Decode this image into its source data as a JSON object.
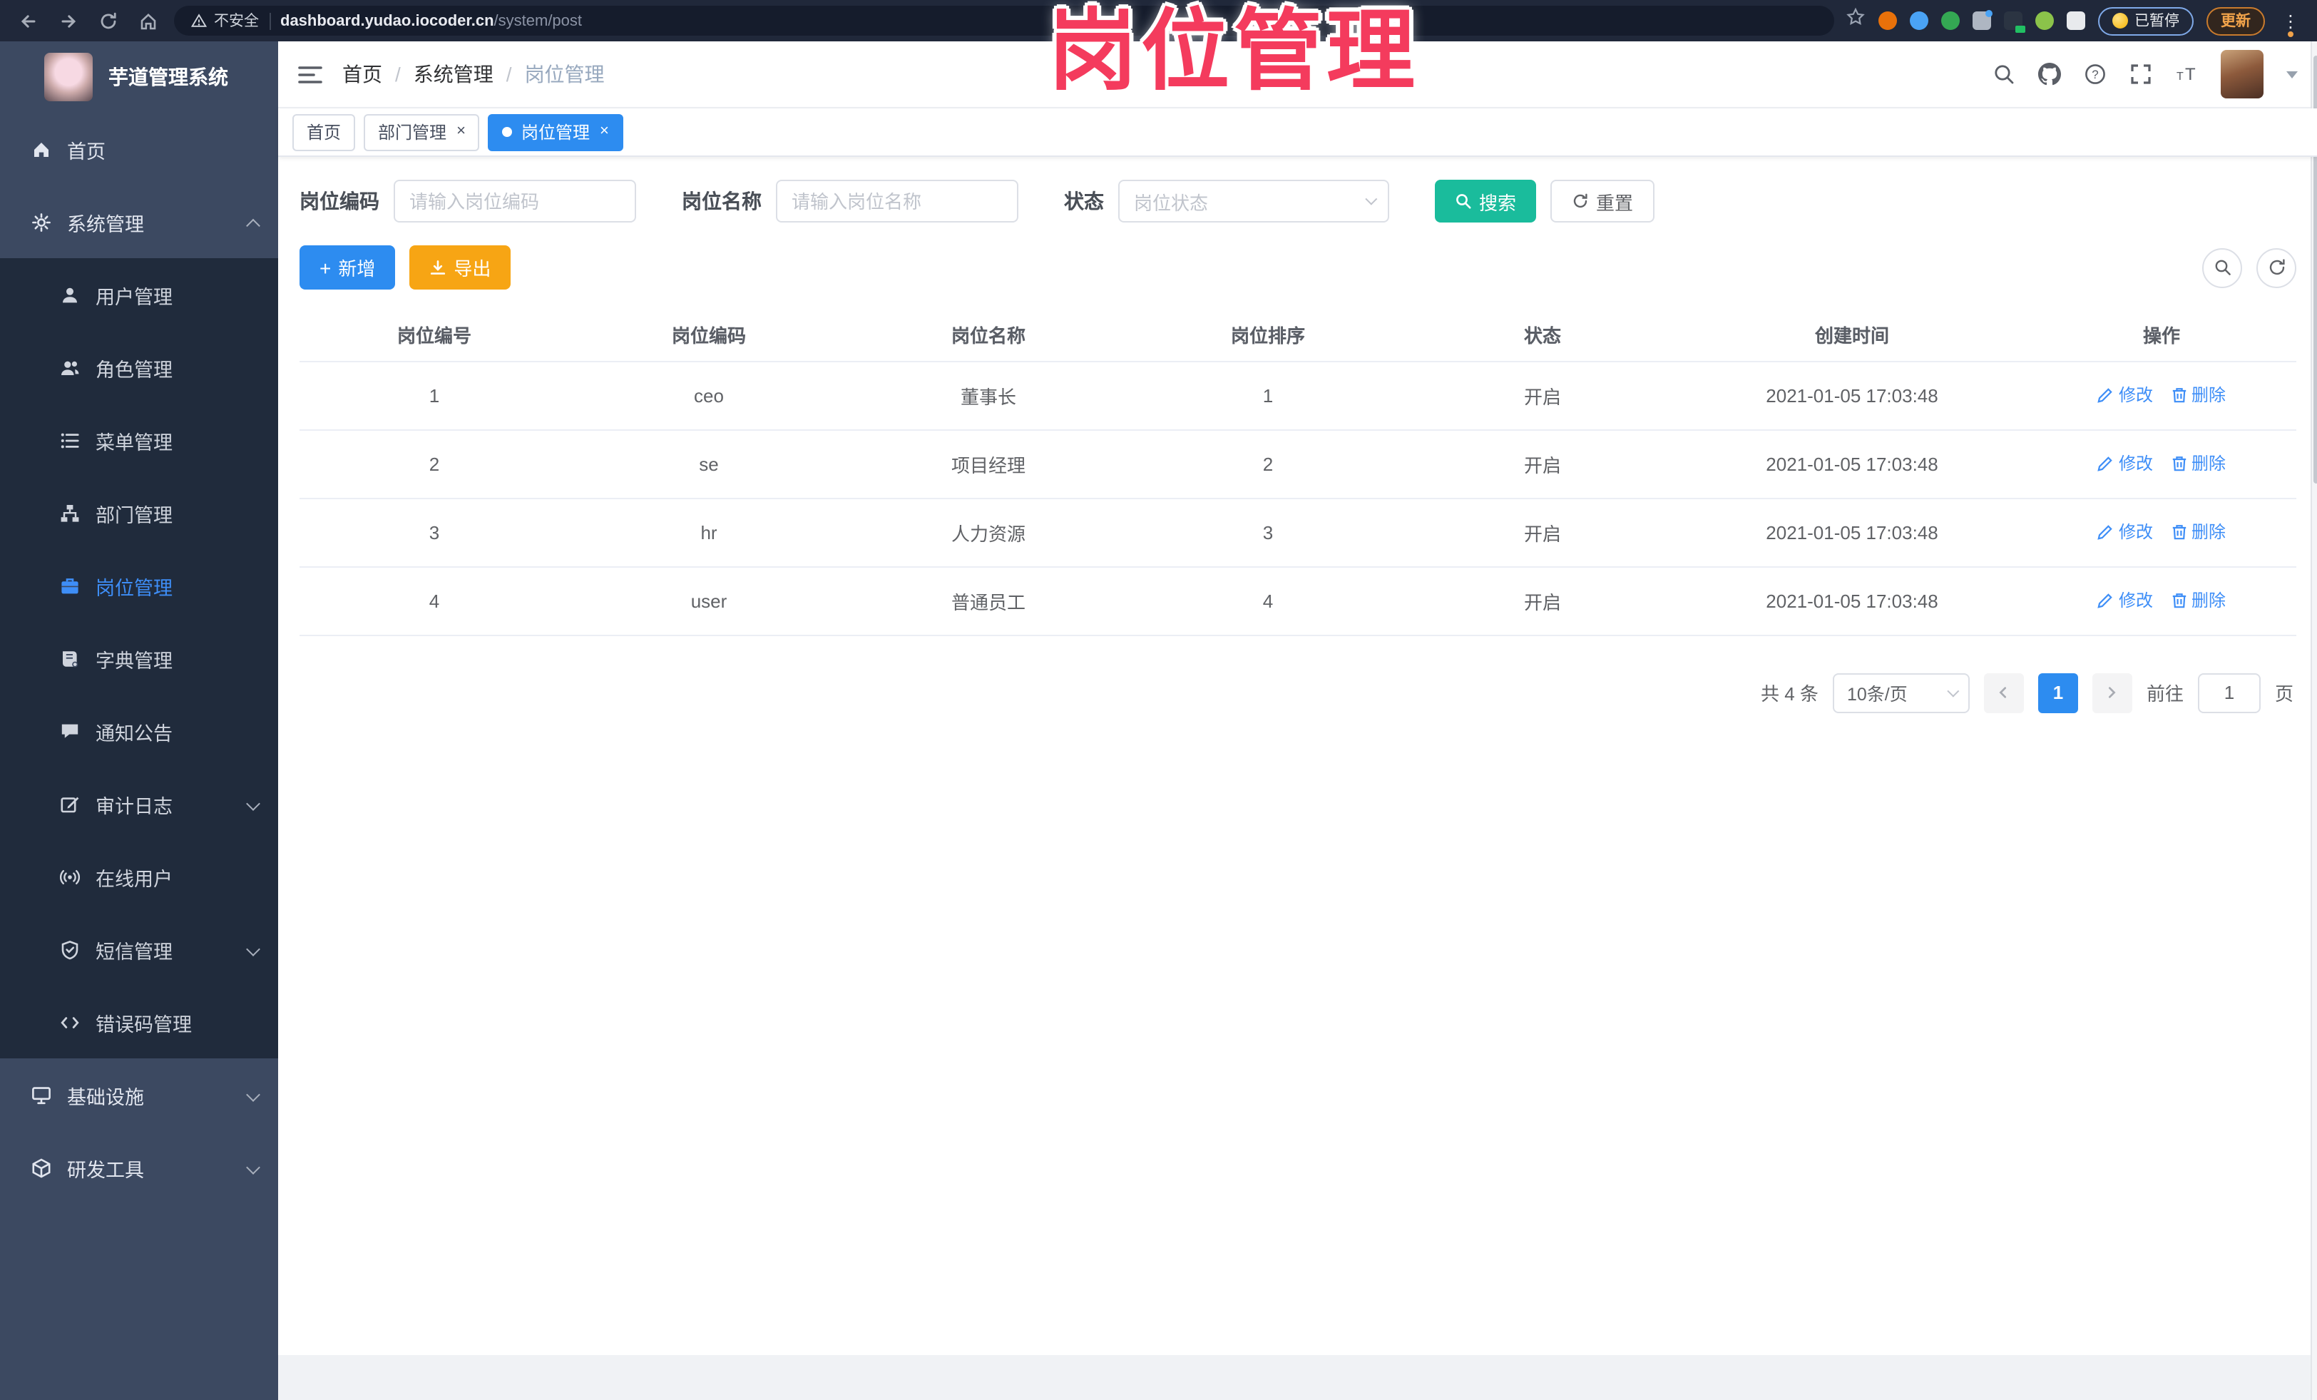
{
  "browser": {
    "security_label": "不安全",
    "url_host": "dashboard.yudao.iocoder.cn",
    "url_path": "/system/post",
    "paused_label": "已暂停",
    "update_label": "更新",
    "extensions": [
      {
        "name": "ext-orange-ring-icon",
        "color": "#e8710a",
        "kind": "circle"
      },
      {
        "name": "ext-blue-drop-icon",
        "color": "#4aa3f5",
        "kind": "circle"
      },
      {
        "name": "ext-green-check-icon",
        "color": "#34a853",
        "kind": "circle"
      },
      {
        "name": "ext-gray-grid-icon",
        "color": "#aeb6c2",
        "kind": "square",
        "bluedot": true
      },
      {
        "name": "ext-dark-badge-icon",
        "color": "#2b3442",
        "kind": "square",
        "badge": true
      },
      {
        "name": "ext-green-sprout-icon",
        "color": "#8bc34a",
        "kind": "circle"
      },
      {
        "name": "extensions-puzzle-icon",
        "color": "#e8eaed",
        "kind": "square"
      }
    ]
  },
  "watermark": "岗位管理",
  "sidebar": {
    "title": "芋道管理系统",
    "items": [
      {
        "key": "home",
        "label": "首页",
        "icon": "home",
        "level": 1,
        "active": false,
        "chevron": null
      },
      {
        "key": "system",
        "label": "系统管理",
        "icon": "gear",
        "level": 1,
        "active": false,
        "chevron": "up"
      },
      {
        "key": "user",
        "label": "用户管理",
        "icon": "user",
        "level": 2,
        "active": false,
        "chevron": null
      },
      {
        "key": "role",
        "label": "角色管理",
        "icon": "users",
        "level": 2,
        "active": false,
        "chevron": null
      },
      {
        "key": "menu",
        "label": "菜单管理",
        "icon": "list",
        "level": 2,
        "active": false,
        "chevron": null
      },
      {
        "key": "dept",
        "label": "部门管理",
        "icon": "tree",
        "level": 2,
        "active": false,
        "chevron": null
      },
      {
        "key": "post",
        "label": "岗位管理",
        "icon": "briefcase",
        "level": 2,
        "active": true,
        "chevron": null
      },
      {
        "key": "dict",
        "label": "字典管理",
        "icon": "book",
        "level": 2,
        "active": false,
        "chevron": null
      },
      {
        "key": "notice",
        "label": "通知公告",
        "icon": "chat",
        "level": 2,
        "active": false,
        "chevron": null
      },
      {
        "key": "audit-log",
        "label": "审计日志",
        "icon": "edit",
        "level": 2,
        "active": false,
        "chevron": "down"
      },
      {
        "key": "online-user",
        "label": "在线用户",
        "icon": "signal",
        "level": 2,
        "active": false,
        "chevron": null
      },
      {
        "key": "sms",
        "label": "短信管理",
        "icon": "shield",
        "level": 2,
        "active": false,
        "chevron": "down"
      },
      {
        "key": "error-code",
        "label": "错误码管理",
        "icon": "code",
        "level": 2,
        "active": false,
        "chevron": null
      },
      {
        "key": "infra",
        "label": "基础设施",
        "icon": "monitor",
        "level": 1,
        "active": false,
        "chevron": "down"
      },
      {
        "key": "dev-tool",
        "label": "研发工具",
        "icon": "box",
        "level": 1,
        "active": false,
        "chevron": "down"
      }
    ]
  },
  "navbar": {
    "breadcrumb": [
      "首页",
      "系统管理",
      "岗位管理"
    ]
  },
  "tabs": [
    {
      "key": "home",
      "label": "首页",
      "closable": false,
      "active": false
    },
    {
      "key": "dept",
      "label": "部门管理",
      "closable": true,
      "active": false
    },
    {
      "key": "post",
      "label": "岗位管理",
      "closable": true,
      "active": true
    }
  ],
  "filters": {
    "post_code_label": "岗位编码",
    "post_code_placeholder": "请输入岗位编码",
    "post_name_label": "岗位名称",
    "post_name_placeholder": "请输入岗位名称",
    "status_label": "状态",
    "status_placeholder": "岗位状态",
    "search_label": "搜索",
    "reset_label": "重置"
  },
  "toolbar": {
    "add_label": "新增",
    "export_label": "导出"
  },
  "table": {
    "headers": [
      "岗位编号",
      "岗位编码",
      "岗位名称",
      "岗位排序",
      "状态",
      "创建时间",
      "操作"
    ],
    "rows": [
      {
        "id": "1",
        "code": "ceo",
        "name": "董事长",
        "sort": "1",
        "status": "开启",
        "created": "2021-01-05 17:03:48"
      },
      {
        "id": "2",
        "code": "se",
        "name": "项目经理",
        "sort": "2",
        "status": "开启",
        "created": "2021-01-05 17:03:48"
      },
      {
        "id": "3",
        "code": "hr",
        "name": "人力资源",
        "sort": "3",
        "status": "开启",
        "created": "2021-01-05 17:03:48"
      },
      {
        "id": "4",
        "code": "user",
        "name": "普通员工",
        "sort": "4",
        "status": "开启",
        "created": "2021-01-05 17:03:48"
      }
    ],
    "edit_label": "修改",
    "delete_label": "删除"
  },
  "pagination": {
    "total_label": "共 4 条",
    "page_size_label": "10条/页",
    "current_page": "1",
    "goto_label": "前往",
    "goto_value": "1",
    "page_unit_label": "页"
  },
  "colors": {
    "primary": "#2d8cf0",
    "search_teal": "#1abc9c",
    "export_orange": "#f7a514",
    "watermark_pink": "#f43b5d",
    "sidebar_bg": "#3c4961",
    "submenu_bg": "#202b3c"
  }
}
